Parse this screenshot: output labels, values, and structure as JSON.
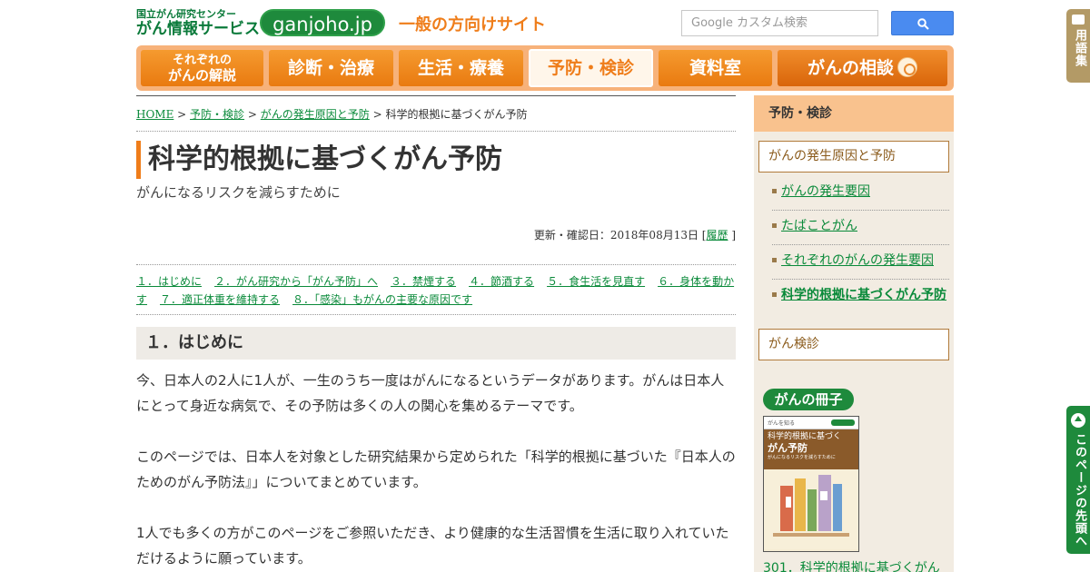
{
  "header": {
    "org_name": "国立がん研究センター",
    "service_name": "がん情報サービス",
    "site_pill": "ganjoho.jp",
    "tagline": "一般の方向けサイト",
    "search_placeholder": "Google カスタム検索",
    "search_icon": "magnifier-icon"
  },
  "nav": {
    "items": [
      {
        "label_line1": "それぞれの",
        "label_line2": "がんの解説"
      },
      {
        "label": "診断・治療"
      },
      {
        "label": "生活・療養"
      },
      {
        "label": "予防・検診"
      },
      {
        "label": "資料室"
      },
      {
        "label": "がんの相談"
      }
    ]
  },
  "breadcrumb": {
    "home": "HOME",
    "sep": " > ",
    "level1": "予防・検診",
    "level2": "がんの発生原因と予防",
    "current": "科学的根拠に基づくがん予防"
  },
  "page": {
    "title": "科学的根拠に基づくがん予防",
    "subtitle": "がんになるリスクを減らすために",
    "updated_label": "更新・確認日：2018年08月13日 [",
    "history_link": "履歴",
    "updated_close": "]"
  },
  "toc": [
    "１．はじめに",
    "２．がん研究から「がん予防」へ",
    "３．禁煙する",
    "４．節酒する",
    "５．食生活を見直す",
    "６．身体を動かす",
    "７．適正体重を維持する",
    "８．「感染」もがんの主要な原因です"
  ],
  "section": {
    "heading": "１．はじめに",
    "paragraphs": [
      "今、日本人の2人に1人が、一生のうち一度はがんになるというデータがあります。がんは日本人にとって身近な病気で、その予防は多くの人の関心を集めるテーマです。",
      "このページでは、日本人を対象とした研究結果から定められた「科学的根拠に基づいた『日本人のためのがん予防法』」についてまとめています。",
      "1人でも多くの方がこのページをご参照いただき、より健康的な生活習慣を生活に取り入れていただけるように願っています。"
    ]
  },
  "sidebar": {
    "heading": "予防・検診",
    "box1": "がんの発生原因と予防",
    "links": [
      "がんの発生要因",
      "たばことがん",
      "それぞれのがんの発生要因",
      "科学的根拠に基づくがん予防"
    ],
    "box2": "がん検診",
    "booklet_badge": "がんの冊子",
    "cover_series": "がんを知る",
    "cover_title_line1": "科学的根拠に基づく",
    "cover_title_line2": "がん予防",
    "cover_subtitle": "がんになるリスクを減らすために",
    "booklet_link": "301．科学的根拠に基づくがん"
  },
  "floating": {
    "glossary": "用語集",
    "page_top": "このページの先頭へ"
  }
}
